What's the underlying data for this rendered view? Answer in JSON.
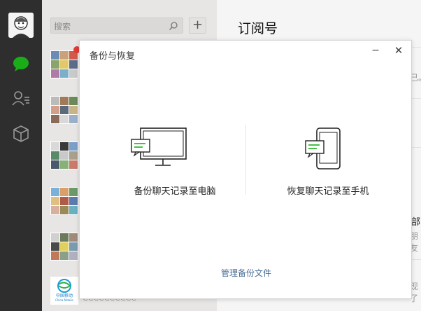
{
  "search": {
    "placeholder": "搜索"
  },
  "add_button": {
    "label": "+"
  },
  "chat_list": {
    "bottom_contact_logo_text": "中国移动",
    "bottom_contact_logo_subtext": "China Mobile",
    "bottom_contact_preview": "CCCCCCCCCC"
  },
  "main": {
    "title": "订阅号",
    "fragments": [
      "己。",
      "部",
      "朋友",
      "现了"
    ]
  },
  "dialog": {
    "title": "备份与恢复",
    "minimize_label": "−",
    "close_label": "✕",
    "backup_label": "备份聊天记录至电脑",
    "restore_label": "恢复聊天记录至手机",
    "manage_label": "管理备份文件"
  },
  "colors": {
    "nav_bg": "#2e2e2e",
    "chat_active": "#1aad19",
    "list_bg": "#e8e6e5",
    "link": "#4a6f97"
  },
  "icons": {
    "nav": [
      "avatar",
      "chat-bubble-icon",
      "contacts-icon",
      "cube-icon"
    ],
    "dialog": [
      "monitor-icon",
      "phone-icon"
    ]
  }
}
